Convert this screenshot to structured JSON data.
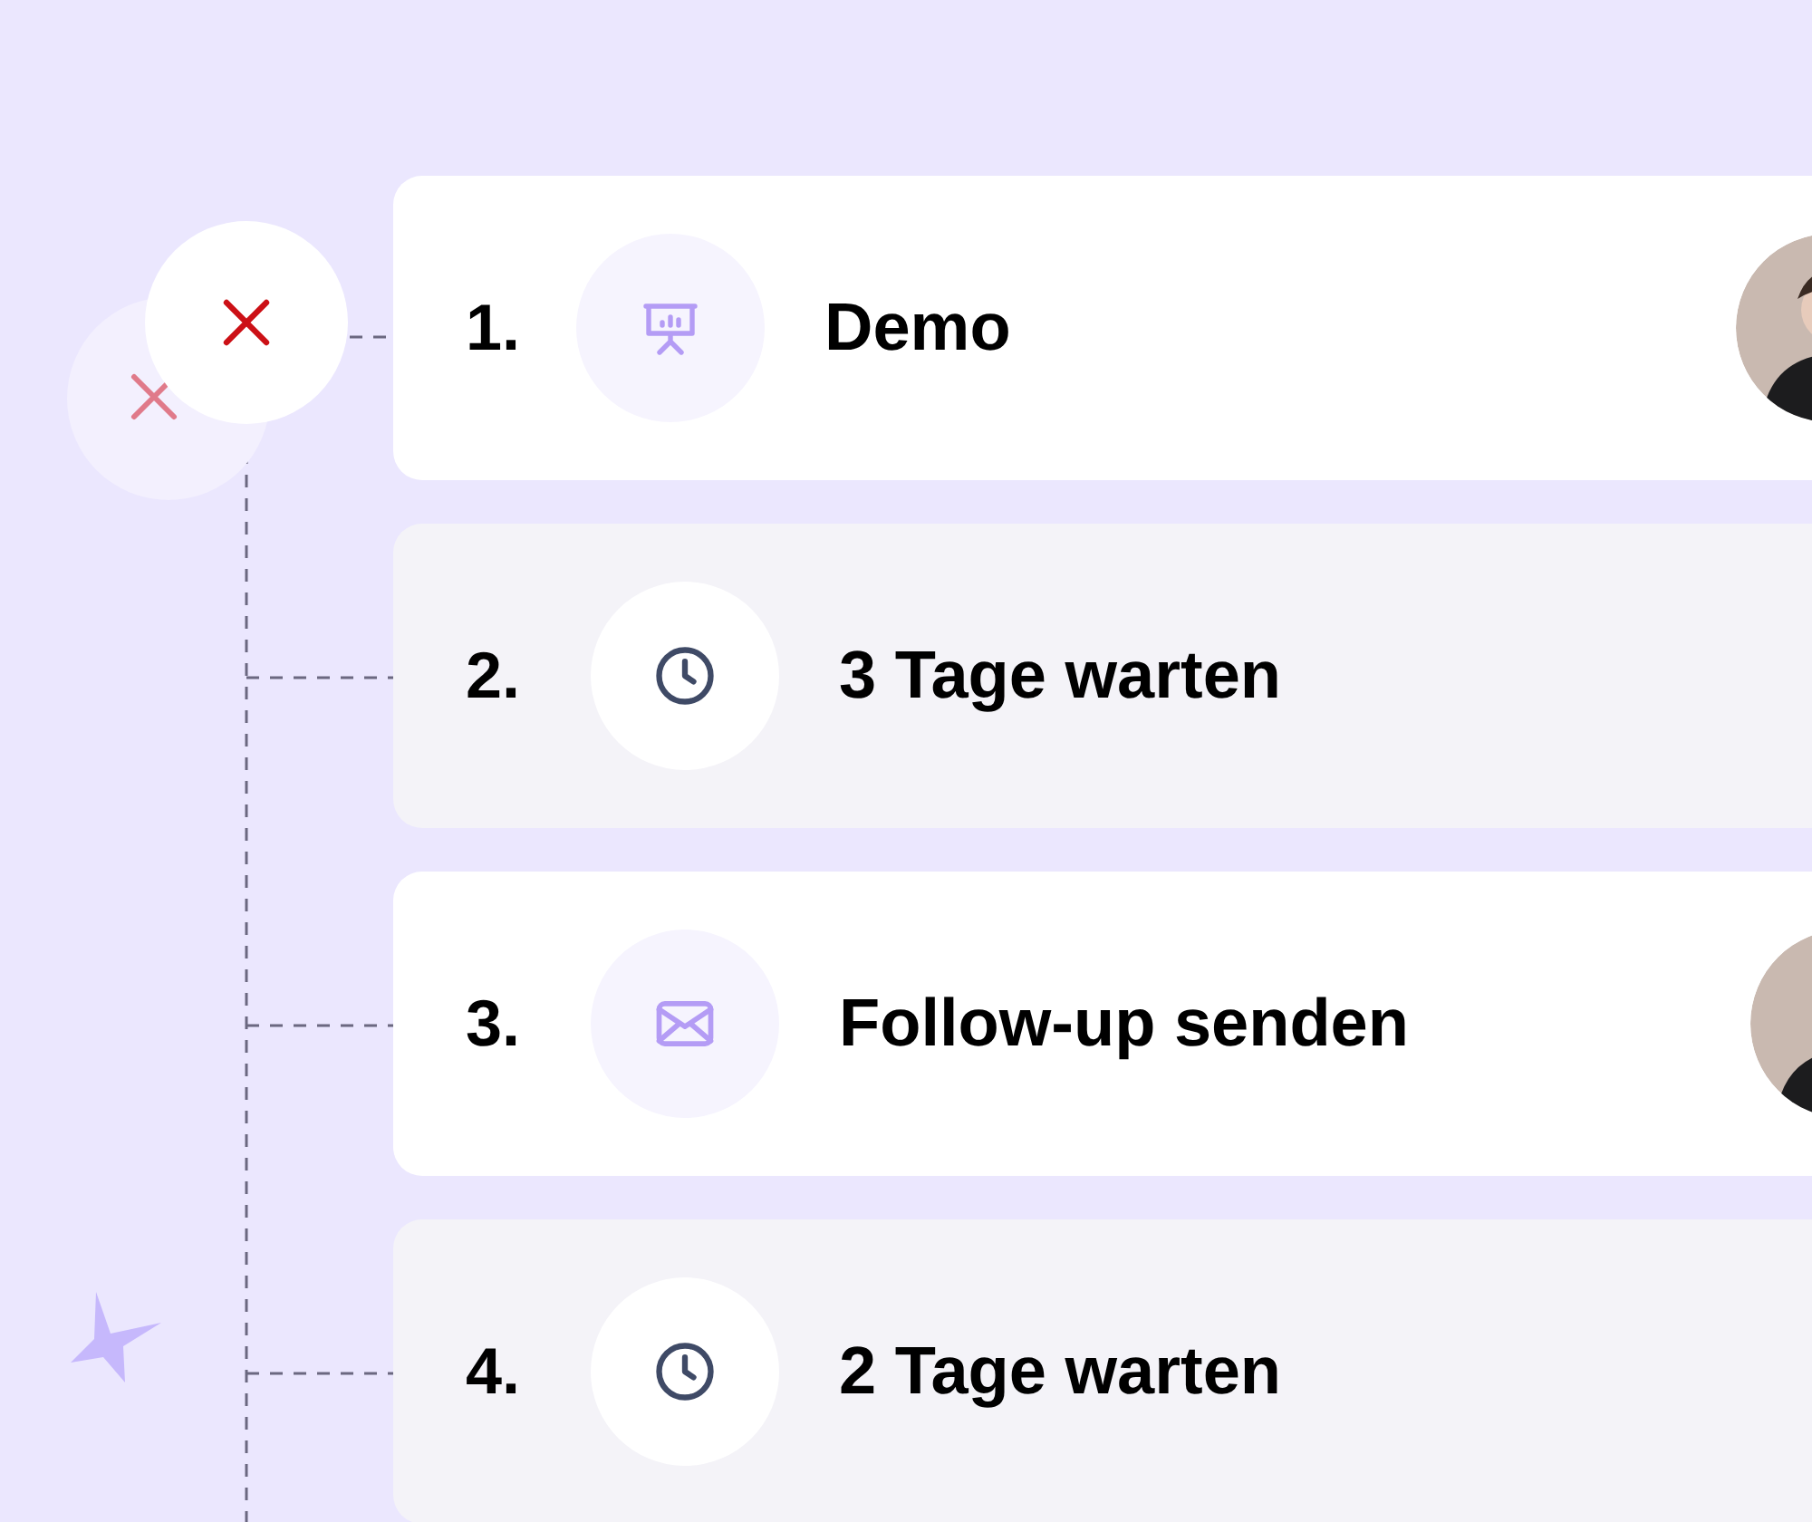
{
  "steps": [
    {
      "number": "1.",
      "title": "Demo",
      "kind": "demo"
    },
    {
      "number": "2.",
      "title": "3 Tage warten",
      "kind": "wait"
    },
    {
      "number": "3.",
      "title": "Follow-up senden",
      "kind": "email"
    },
    {
      "number": "4.",
      "title": "2 Tage warten",
      "kind": "wait"
    }
  ]
}
